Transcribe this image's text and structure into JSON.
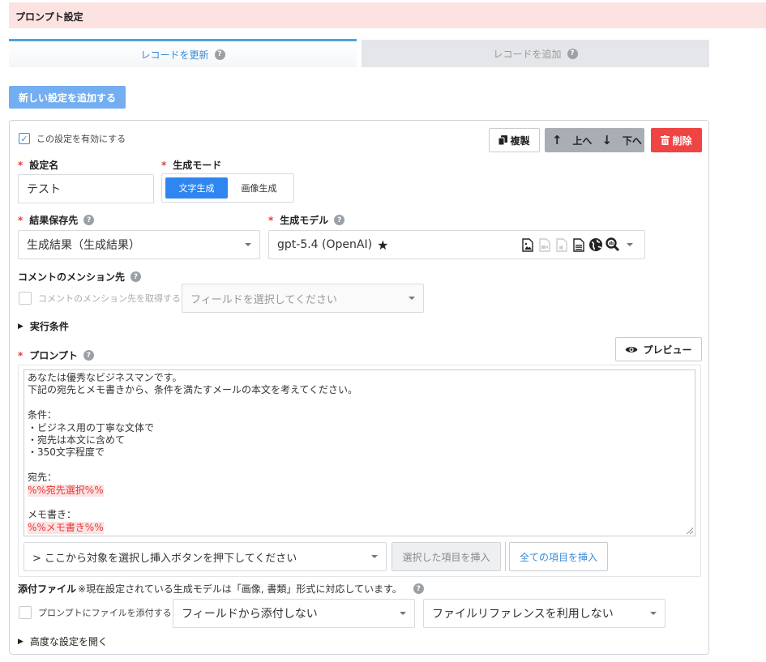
{
  "header": {
    "title": "プロンプト設定"
  },
  "tabs": [
    {
      "label": "レコードを更新",
      "active": true
    },
    {
      "label": "レコードを追加",
      "active": false
    }
  ],
  "new_setting_button": "新しい設定を追加する",
  "card": {
    "enable_label": "この設定を有効にする",
    "enabled": true,
    "copy_button": "複製",
    "up_button": "上へ",
    "down_button": "下へ",
    "delete_button": "削除",
    "name_label": "設定名",
    "name_value": "テスト",
    "mode_label": "生成モード",
    "mode_options": [
      "文字生成",
      "画像生成"
    ],
    "mode_selected": "文字生成",
    "result_label": "結果保存先",
    "result_value": "生成結果（生成結果）",
    "model_label": "生成モデル",
    "model_value": "gpt-5.4 (OpenAI)",
    "model_icons": [
      "image-file-icon",
      "video-file-icon",
      "audio-file-icon",
      "document-icon",
      "web-globe-icon",
      "deep-search-icon"
    ],
    "mention_label": "コメントのメンション先",
    "mention_checkbox_label": "コメントのメンション先を取得する",
    "mention_field_placeholder": "フィールドを選択してください",
    "conditions_label": "実行条件",
    "prompt_label": "プロンプト",
    "preview_button": "プレビュー",
    "prompt_lines": [
      {
        "text": "あなたは優秀なビジネスマンです。",
        "placeholder": false
      },
      {
        "text": "下記の宛先とメモ書きから、条件を満たすメールの本文を考えてください。",
        "placeholder": false
      },
      {
        "text": "",
        "placeholder": false
      },
      {
        "text": "条件：",
        "placeholder": false
      },
      {
        "text": "・ビジネス用の丁寧な文体で",
        "placeholder": false
      },
      {
        "text": "・宛先は本文に含めて",
        "placeholder": false
      },
      {
        "text": "・350文字程度で",
        "placeholder": false
      },
      {
        "text": "",
        "placeholder": false
      },
      {
        "text": "宛先：",
        "placeholder": false
      },
      {
        "text": "%%宛先選択%%",
        "placeholder": true
      },
      {
        "text": "",
        "placeholder": false
      },
      {
        "text": "メモ書き：",
        "placeholder": false
      },
      {
        "text": "%%メモ書き%%",
        "placeholder": true
      }
    ],
    "insert_select_placeholder": "> ここから対象を選択し挿入ボタンを押下してください",
    "insert_selected_button": "選択した項目を挿入",
    "insert_all_button": "全ての項目を挿入",
    "attach_label": "添付ファイル",
    "attach_note": "※現在設定されている生成モデルは「画像, 書類」形式に対応しています。",
    "attach_checkbox_label": "プロンプトにファイルを添付する",
    "attach_field_value": "フィールドから添付しない",
    "file_reference_value": "ファイルリファレンスを利用しない",
    "advanced_label": "高度な設定を開く"
  },
  "colors": {
    "accent": "#2f86f0",
    "danger": "#ef4444",
    "header_bg": "#fde2e2",
    "placeholder_hl": "#fbe3e3"
  }
}
